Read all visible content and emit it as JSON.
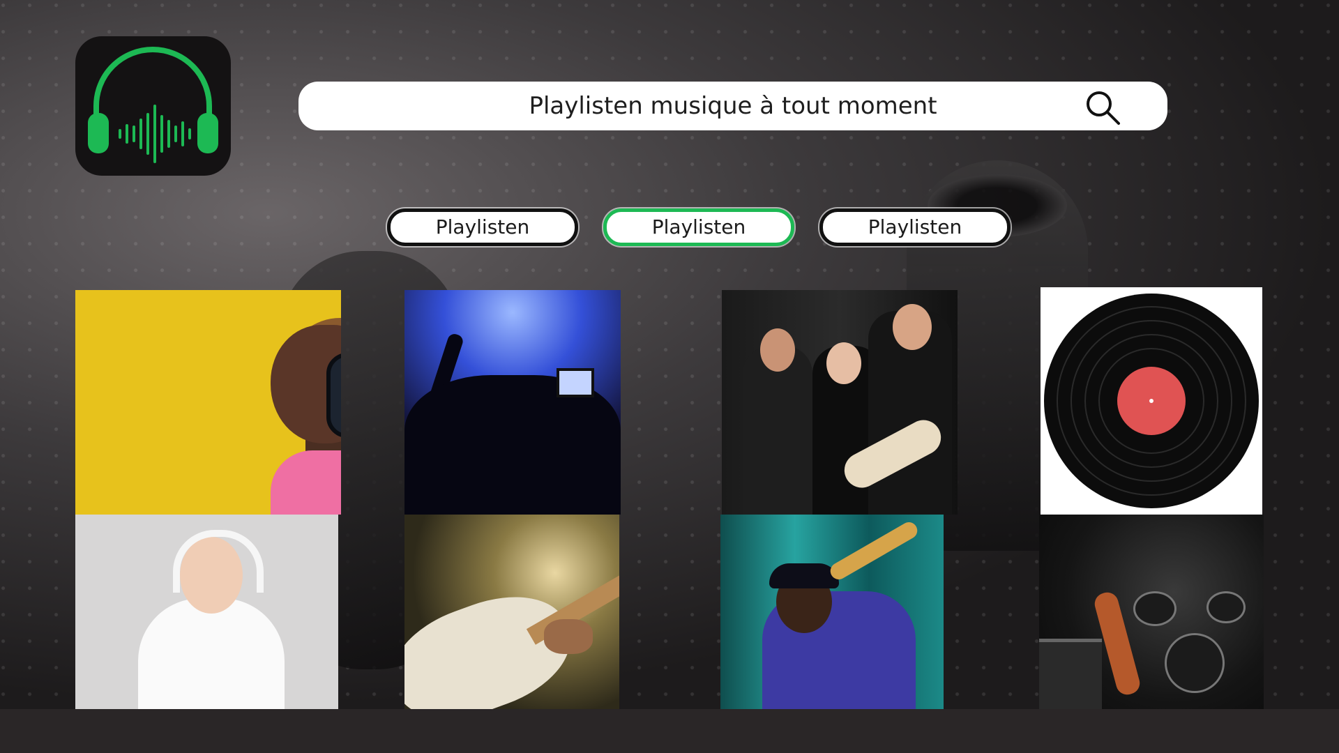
{
  "search": {
    "placeholder": "Playlisten musique à tout moment"
  },
  "tabs": [
    {
      "label": "Playlisten",
      "active": false
    },
    {
      "label": "Playlisten",
      "active": true
    },
    {
      "label": "Playlisten",
      "active": false
    }
  ],
  "colors": {
    "accent": "#1db954",
    "logo_bg": "#141213",
    "record_label": "#e05353"
  },
  "icons": {
    "logo": "headphones-icon",
    "search": "search-icon"
  }
}
